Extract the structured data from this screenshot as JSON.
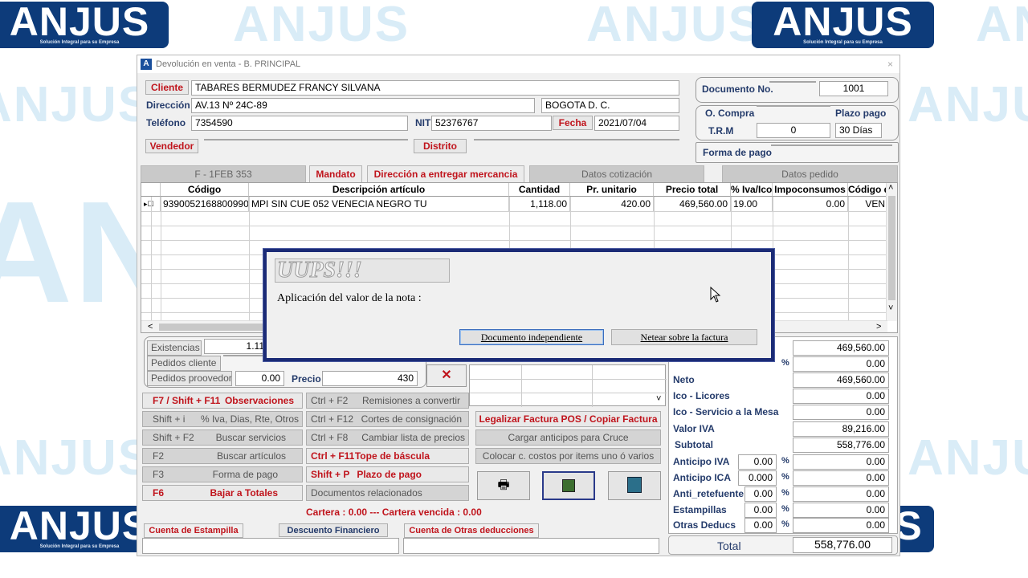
{
  "watermark": {
    "brand": "ANJUS",
    "tagline": "Solución Integral para su Empresa"
  },
  "window": {
    "title": "Devolución en venta   - B. PRINCIPAL",
    "icon_letter": "A",
    "close": "×"
  },
  "customer": {
    "cliente_label": "Cliente",
    "cliente_value": "TABARES BERMUDEZ FRANCY SILVANA",
    "direccion_label": "Dirección",
    "direccion_value": "AV.13  Nº 24C-89",
    "ciudad_value": "BOGOTA D. C.",
    "telefono_label": "Teléfono",
    "telefono_value": "7354590",
    "nit_label": "NIT",
    "nit_value": "52376767",
    "fecha_label": "Fecha",
    "fecha_value": "2021/07/04",
    "vendedor_label": "Vendedor",
    "vendedor_value": "",
    "distrito_label": "Distrito",
    "distrito_value": ""
  },
  "document": {
    "doc_no_label": "Documento No.",
    "doc_prefix": "",
    "doc_number": "1001",
    "ocompra_label": "O. Compra",
    "ocompra_value": "",
    "plazo_label": "Plazo pago",
    "trm_label": "T.R.M",
    "trm_value": "0",
    "plazo_value": "30 Días",
    "forma_pago_label": "Forma de pago",
    "forma_pago_value": ""
  },
  "tabs": [
    "F  -  1FEB   353",
    "Mandato",
    "Dirección a entregar mercancia",
    "Datos cotización",
    "Datos pedido"
  ],
  "grid": {
    "headers": [
      "Código",
      "Descripción artículo",
      "Cantidad",
      "Pr. unitario",
      "Precio total",
      "% Iva/Ico",
      "Impoconsumos",
      "Código d"
    ],
    "rows": [
      [
        "9390052168800990",
        "MPI SIN CUE 052 VENECIA NEGRO TU",
        "1,118.00",
        "420.00",
        "469,560.00",
        "19.00",
        "0.00",
        "VEN"
      ]
    ],
    "scroll_up": "˄",
    "scroll_down": "˅",
    "scroll_left": "<",
    "scroll_right": ">"
  },
  "stock": {
    "existencias_label": "Existencias",
    "existencias_value": "1.11",
    "pedidos_cliente_label": "Pedidos cliente",
    "pedidos_cliente_value": "",
    "pedidos_proveedor_label": "Pedidos proovedor",
    "pedidos_proveedor_value": "0.00",
    "precio_label": "Precio",
    "precio_value": "430"
  },
  "buttons": {
    "observaciones_key": "F7 / Shift + F11",
    "observaciones": "Observaciones",
    "iva_key": "Shift + i",
    "iva": "% Iva, Dias, Rte, Otros",
    "buscar_serv_key": "Shift + F2",
    "buscar_serv": "Buscar servicios",
    "buscar_art_key": "F2",
    "buscar_art": "Buscar artículos",
    "forma_pago_key": "F3",
    "forma_pago": "Forma de pago",
    "bajar_key": "F6",
    "bajar": "Bajar a Totales",
    "remisiones_key": "Ctrl + F2",
    "remisiones": "Remisiones a convertir",
    "cortes_key": "Ctrl + F12",
    "cortes": "Cortes de consignación",
    "cambiar_key": "Ctrl + F8",
    "cambiar": "Cambiar lista de precios",
    "tope_key": "Ctrl + F11",
    "tope": "Tope de báscula",
    "plazo_key": "Shift + P",
    "plazo": "Plazo de pago",
    "documentos": "Documentos relacionados",
    "legalizar": "Legalizar Factura POS / Copiar Factura",
    "anticipos": "Cargar anticipos para Cruce",
    "centros": "Colocar c. costos por items uno ó varios"
  },
  "cartera": "Cartera : 0.00   --- Cartera vencida : 0.00",
  "bottom": {
    "estampilla": "Cuenta de Estampilla",
    "descuento": "Descuento Financiero",
    "otras": "Cuenta de Otras deducciones"
  },
  "totals": {
    "bruto": "469,560.00",
    "descuento_value": "0.00",
    "neto_label": "Neto",
    "neto": "469,560.00",
    "ico_licores_label": "Ico - Licores",
    "ico_licores": "0.00",
    "ico_mesa_label": "Ico - Servicio a la Mesa",
    "ico_mesa": "0.00",
    "iva_label": "Valor IVA",
    "iva": "89,216.00",
    "subtotal_label": "Subtotal",
    "subtotal": "558,776.00",
    "anticipo_iva_label": "Anticipo IVA",
    "anticipo_iva_pct": "0.00",
    "anticipo_iva": "0.00",
    "anticipo_ica_label": "Anticipo ICA",
    "anticipo_ica_pct": "0.000",
    "anticipo_ica": "0.00",
    "anti_rete_label": "Anti_retefuente",
    "anti_rete_pct": "0.00",
    "anti_rete": "0.00",
    "estampillas_label": "Estampillas",
    "estampillas_pct": "0.00",
    "estampillas": "0.00",
    "otras_label": "Otras Deducs",
    "otras_pct": "0.00",
    "otras": "0.00",
    "pct_symbol": "%",
    "total_label": "Total",
    "total": "558,776.00"
  },
  "dialog": {
    "heading": "UUPS!!!",
    "message": "Aplicación del valor de la nota :",
    "btn1": "Documento independiente",
    "btn2": "Netear sobre la factura"
  },
  "colors": {
    "accent_red": "#c0141c",
    "label_blue": "#243b6b",
    "dialog_border": "#1b2b76",
    "brand": "#0d3b7a"
  }
}
